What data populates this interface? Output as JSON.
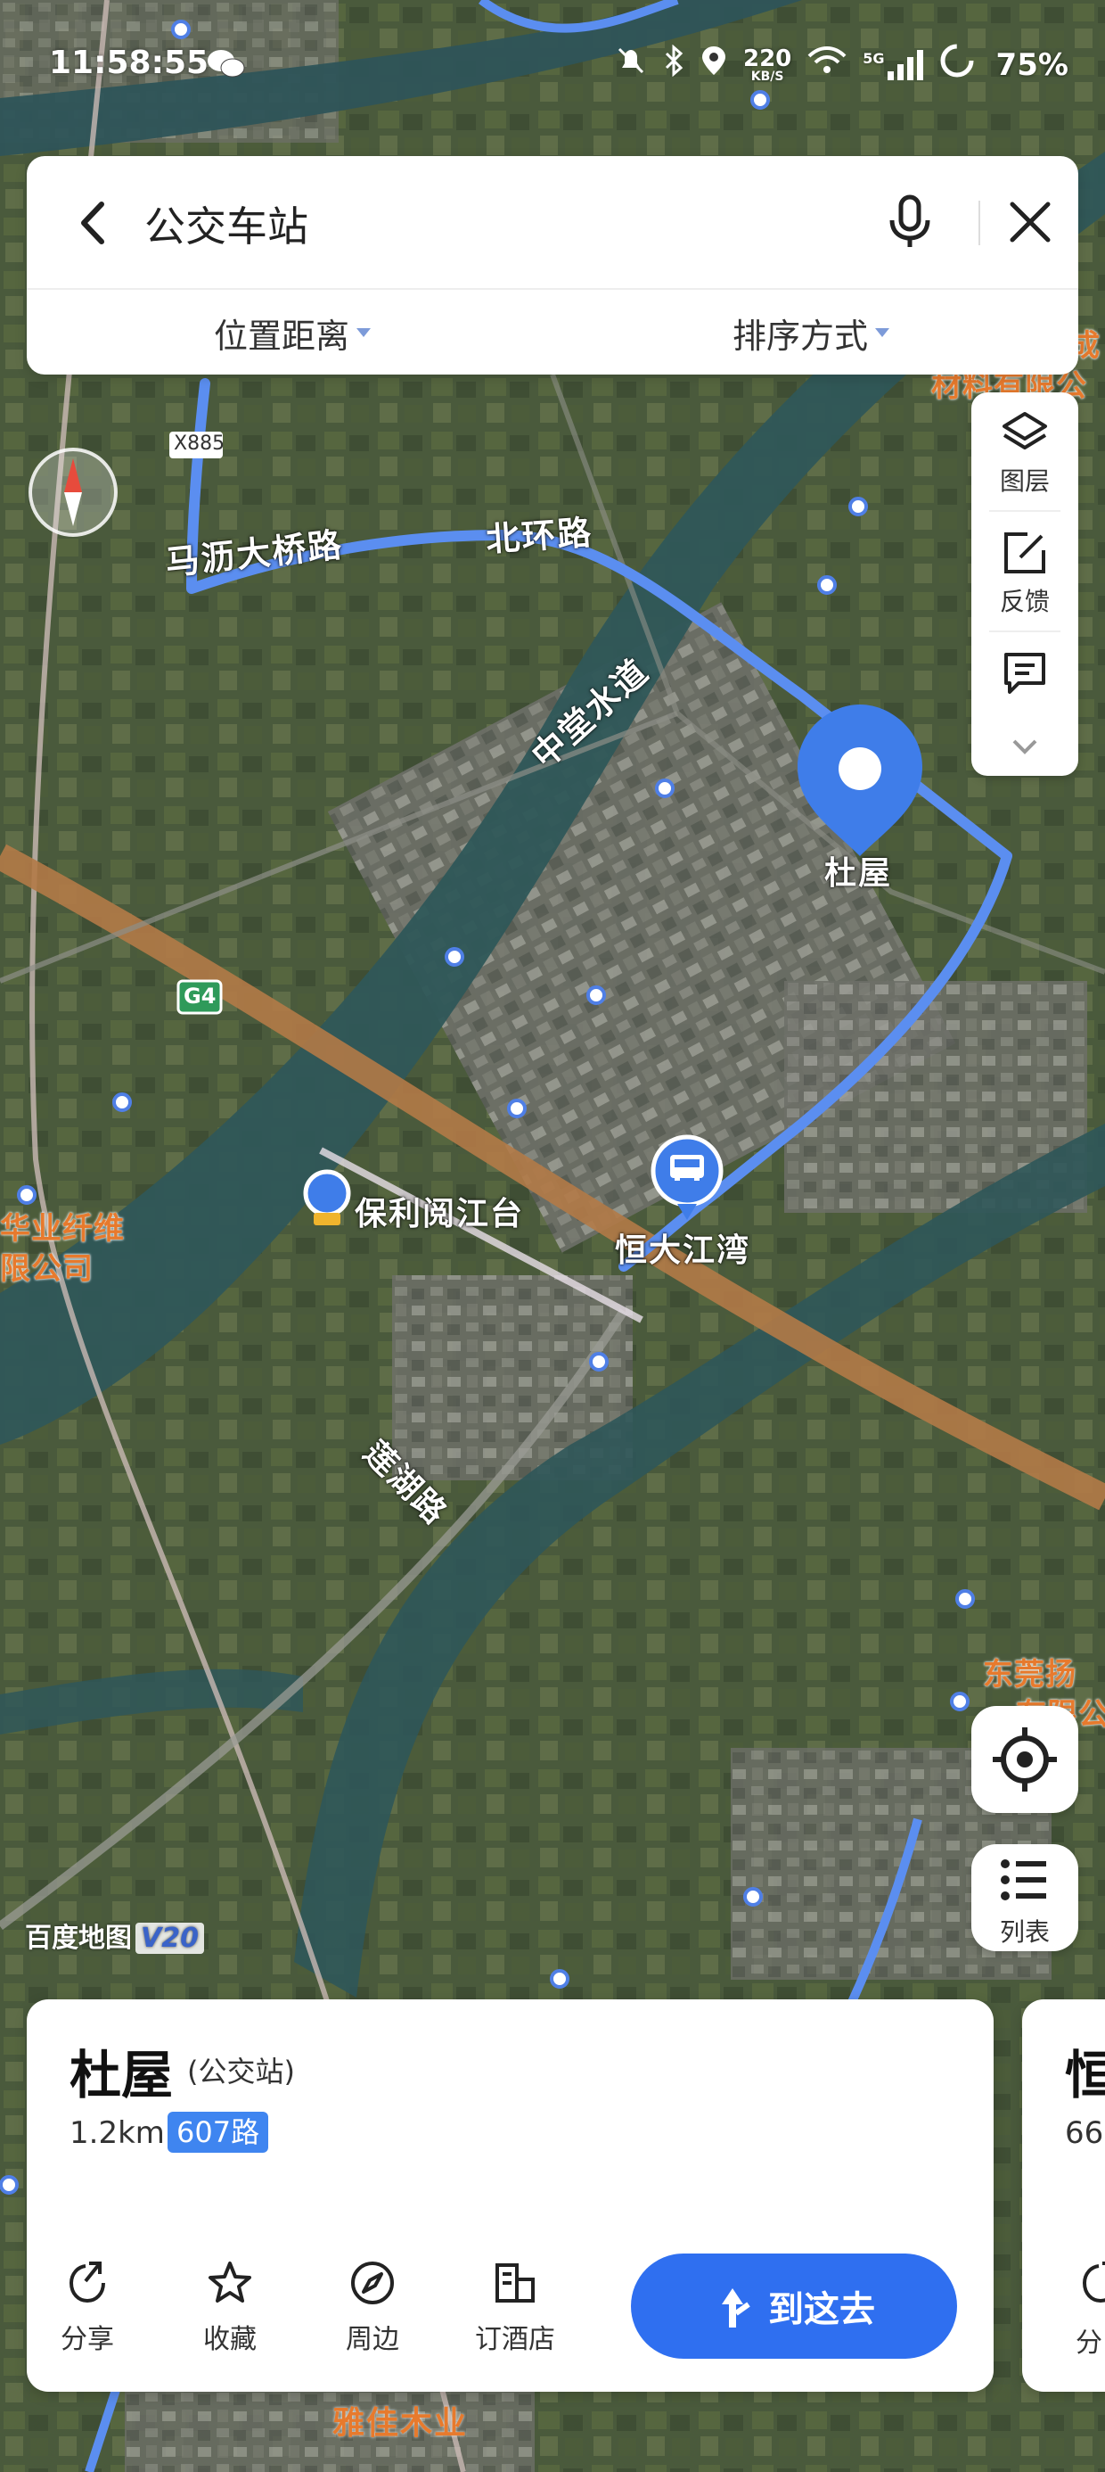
{
  "status_bar": {
    "time": "11:58:55",
    "net_speed_top": "220",
    "net_speed_bottom": "KB/S",
    "network": "5G",
    "battery": "75%"
  },
  "search": {
    "query": "公交车站",
    "filters": [
      "位置距离",
      "排序方式"
    ]
  },
  "side_tools": {
    "layers_label": "图层",
    "feedback_label": "反馈"
  },
  "map": {
    "roads": {
      "mali_bridge_road": "马沥大桥路",
      "north_ring_road": "北环路",
      "zhongtang_waterway": "中堂水道",
      "lianhu_road": "莲湖路",
      "x885": "X885",
      "g4": "G4"
    },
    "places": {
      "duwu": "杜屋",
      "poly": "保利阅江台",
      "evergrande": "恒大江湾",
      "yajia": "雅佳木业",
      "company_left_1": "华业纤维",
      "company_left_2": "限公司",
      "company_top_right_1": "成",
      "company_top_right_2": "材料有限公",
      "company_right_1": "东莞扬",
      "company_right_2": "有限公"
    },
    "watermark": "百度地图",
    "watermark_version": "V20",
    "colors": {
      "route": "#5b8ef0",
      "marker": "#2f6ff0",
      "label_orange": "#e77a2d"
    }
  },
  "controls": {
    "list_label": "列表"
  },
  "result": {
    "name": "杜屋",
    "type": "(公交站)",
    "distance": "1.2km",
    "route": "607路",
    "actions": [
      "分享",
      "收藏",
      "周边",
      "订酒店"
    ],
    "go_label": "到这去"
  },
  "next_result": {
    "name_partial": "恒",
    "distance_partial": "66",
    "action_partial": "分"
  }
}
